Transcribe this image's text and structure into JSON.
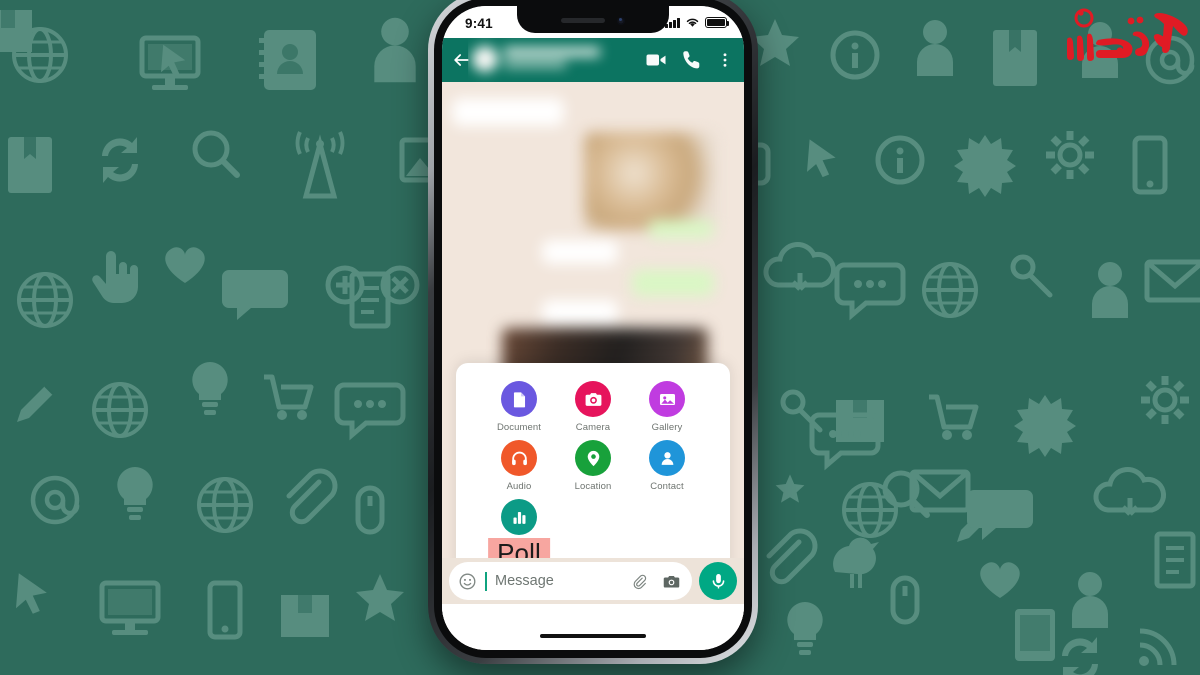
{
  "page": {
    "background_color": "#2e6b5c",
    "pattern_icon_color": "#5f9486"
  },
  "watermark": {
    "name": "aftabnet-persian-logo",
    "text": "آکتربازار",
    "color": "#e01b24"
  },
  "phone": {
    "frame_color": "#1b1d20",
    "screen_background": "#ffffff"
  },
  "status_bar": {
    "time": "9:41",
    "signal_icon": "cellular-signal-icon",
    "wifi_icon": "wifi-icon",
    "battery_icon": "battery-full-icon"
  },
  "chat_header": {
    "background_color": "#0c7461",
    "back_icon": "back-arrow-icon",
    "contact_name_blurred": "",
    "video_call_icon": "video-camera-icon",
    "voice_call_icon": "phone-icon",
    "overflow_icon": "three-dots-menu-icon"
  },
  "chat_body": {
    "background_color": "#f2e6dc",
    "messages_blurred": true
  },
  "attachment_panel": {
    "background_color": "#ffffff",
    "items": [
      {
        "label": "Document",
        "icon": "document-icon",
        "color": "#6a58e0"
      },
      {
        "label": "Camera",
        "icon": "camera-icon",
        "color": "#e6145c"
      },
      {
        "label": "Gallery",
        "icon": "gallery-icon",
        "color": "#c03ce0"
      },
      {
        "label": "Audio",
        "icon": "headphones-icon",
        "color": "#f0582a"
      },
      {
        "label": "Location",
        "icon": "map-pin-icon",
        "color": "#18a13b"
      },
      {
        "label": "Contact",
        "icon": "person-icon",
        "color": "#1f95d9"
      },
      {
        "label": "Poll",
        "icon": "bar-chart-icon",
        "color": "#0c9b86"
      }
    ],
    "highlight": {
      "target_label": "Poll",
      "highlight_color": "#f7a6a0"
    }
  },
  "input_bar": {
    "background_color": "#ede3d9",
    "emoji_icon": "smiley-face-icon",
    "placeholder": "Message",
    "value": "",
    "cursor_color": "#0fa37f",
    "attach_icon": "paperclip-icon",
    "camera_icon": "camera-icon",
    "mic_icon": "microphone-icon",
    "mic_button_color": "#00a884"
  },
  "home_indicator": {
    "name": "home-indicator-bar"
  }
}
